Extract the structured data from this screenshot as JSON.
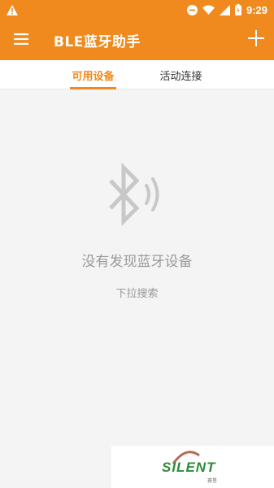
{
  "statusbar": {
    "time": "9:29",
    "icons": [
      "warning-icon",
      "dnd-icon",
      "wifi-icon",
      "signal-icon",
      "battery-icon"
    ]
  },
  "appbar": {
    "title": "BLE蓝牙助手",
    "icons": [
      "menu-icon",
      "add-icon"
    ]
  },
  "tabs": [
    {
      "label": "可用设备",
      "active": true
    },
    {
      "label": "活动连接",
      "active": false
    }
  ],
  "empty_state": {
    "title": "没有发现蓝牙设备",
    "hint": "下拉搜索",
    "icon": "bluetooth-searching-icon"
  },
  "watermark": {
    "text": "SILENT",
    "sub": "赛垦"
  },
  "colors": {
    "primary": "#f08a1e",
    "text_muted": "#9a9a9a",
    "background": "#f4f4f4"
  }
}
